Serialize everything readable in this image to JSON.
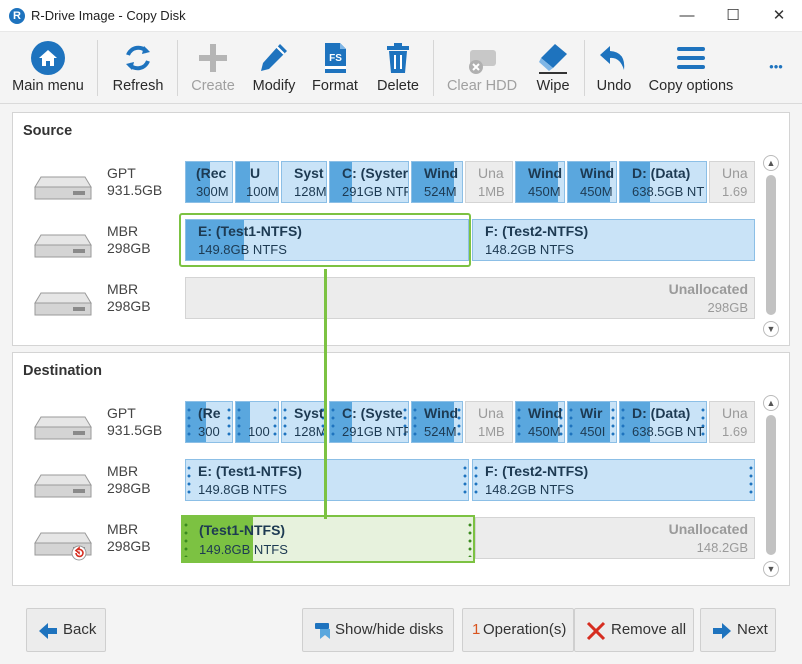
{
  "window": {
    "title": "R-Drive Image - Copy Disk",
    "app_icon_letter": "R",
    "minimize": "—",
    "maximize": "☐",
    "close": "✕"
  },
  "toolbar": {
    "main_menu": "Main menu",
    "refresh": "Refresh",
    "create": "Create",
    "modify": "Modify",
    "format": "Format",
    "format_icon_text": "FS",
    "delete": "Delete",
    "clear_hdd": "Clear HDD",
    "wipe": "Wipe",
    "undo": "Undo",
    "copy_options": "Copy options",
    "more": "•••"
  },
  "source": {
    "title": "Source",
    "disks": [
      {
        "type": "GPT",
        "size": "931.5GB",
        "partitions": [
          {
            "name": "(Rec",
            "size": "300M"
          },
          {
            "name": "U",
            "size": "100M"
          },
          {
            "name": "Syst",
            "size": "128M"
          },
          {
            "name": "C: (Syster",
            "size": "291GB NTF"
          },
          {
            "name": "Wind",
            "size": "524M"
          },
          {
            "name": "Una",
            "size": "1MB"
          },
          {
            "name": "Wind",
            "size": "450M"
          },
          {
            "name": "Wind",
            "size": "450M"
          },
          {
            "name": "D: (Data)",
            "size": "638.5GB NT"
          },
          {
            "name": "Una",
            "size": "1.69"
          }
        ]
      },
      {
        "type": "MBR",
        "size": "298GB",
        "partitions": [
          {
            "name": "E: (Test1-NTFS)",
            "size": "149.8GB NTFS"
          },
          {
            "name": "F: (Test2-NTFS)",
            "size": "148.2GB NTFS"
          }
        ]
      },
      {
        "type": "MBR",
        "size": "298GB",
        "partitions": [
          {
            "name": "Unallocated",
            "size": "298GB"
          }
        ]
      }
    ]
  },
  "destination": {
    "title": "Destination",
    "disks": [
      {
        "type": "GPT",
        "size": "931.5GB",
        "partitions": [
          {
            "name": "(Re",
            "size": "300"
          },
          {
            "name": "",
            "size": "100"
          },
          {
            "name": "Syst",
            "size": "128M"
          },
          {
            "name": "C: (Syste",
            "size": "291GB NTF"
          },
          {
            "name": "Wind",
            "size": "524M"
          },
          {
            "name": "Una",
            "size": "1MB"
          },
          {
            "name": "Wind",
            "size": "450M"
          },
          {
            "name": "Wir",
            "size": "450I"
          },
          {
            "name": "D: (Data)",
            "size": "638.5GB NT"
          },
          {
            "name": "Una",
            "size": "1.69"
          }
        ]
      },
      {
        "type": "MBR",
        "size": "298GB",
        "partitions": [
          {
            "name": "E: (Test1-NTFS)",
            "size": "149.8GB NTFS"
          },
          {
            "name": "F: (Test2-NTFS)",
            "size": "148.2GB NTFS"
          }
        ]
      },
      {
        "type": "MBR",
        "size": "298GB",
        "partitions": [
          {
            "name": "(Test1-NTFS)",
            "size": "149.8GB NTFS"
          },
          {
            "name": "Unallocated",
            "size": "148.2GB"
          }
        ]
      }
    ]
  },
  "bottom": {
    "back": "Back",
    "show_hide_disks": "Show/hide disks",
    "operations_count": "1",
    "operations": "Operation(s)",
    "remove_all": "Remove all",
    "next": "Next"
  },
  "colors": {
    "accent": "#1e73be",
    "partition_fill": "#5aa7de",
    "partition_bg": "#c9e3f7",
    "selection": "#7cc242"
  }
}
